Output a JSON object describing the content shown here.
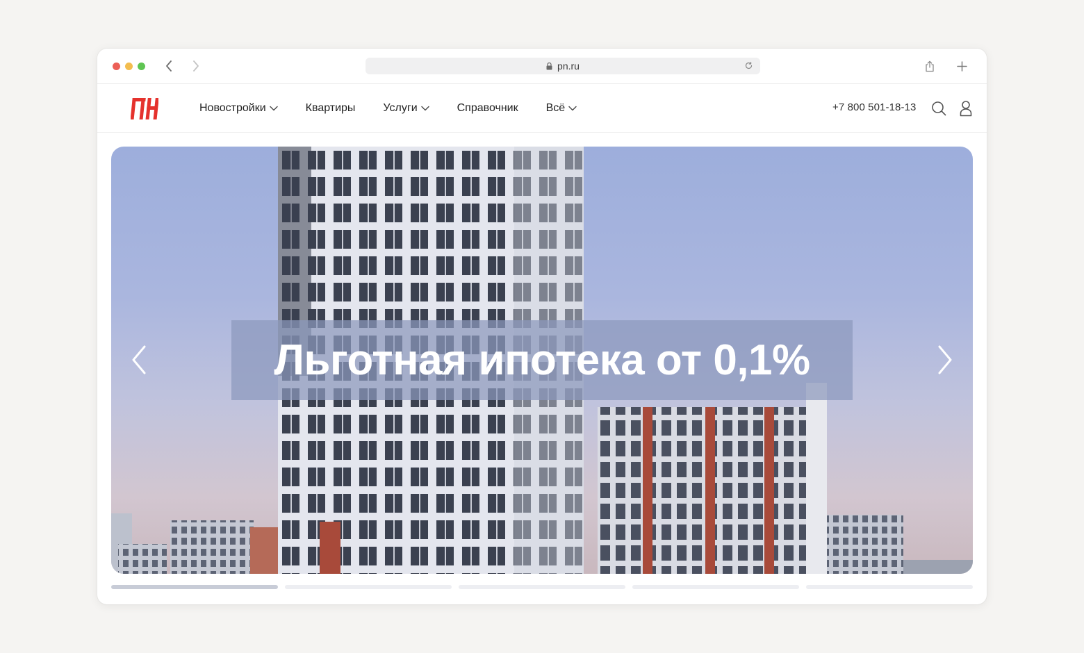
{
  "browser": {
    "url": "pn.ru",
    "icons": {
      "back": "chevron-left-icon",
      "forward": "chevron-right-icon",
      "lock": "lock-icon",
      "reload": "reload-icon",
      "share": "share-icon",
      "new_tab": "plus-icon"
    }
  },
  "site": {
    "logo_text": "ПН",
    "brand_color": "#e5322d",
    "nav": [
      {
        "label": "Новостройки",
        "dropdown": true
      },
      {
        "label": "Квартиры",
        "dropdown": false
      },
      {
        "label": "Услуги",
        "dropdown": true
      },
      {
        "label": "Справочник",
        "dropdown": false
      },
      {
        "label": "Всё",
        "dropdown": true
      }
    ],
    "phone": "+7 800 501-18-13",
    "icons": {
      "search": "search-icon",
      "account": "user-icon"
    }
  },
  "hero": {
    "headline": "Льготная ипотека от 0,1%",
    "slides_total": 5,
    "active_slide": 1,
    "active_progress": 1.0
  }
}
